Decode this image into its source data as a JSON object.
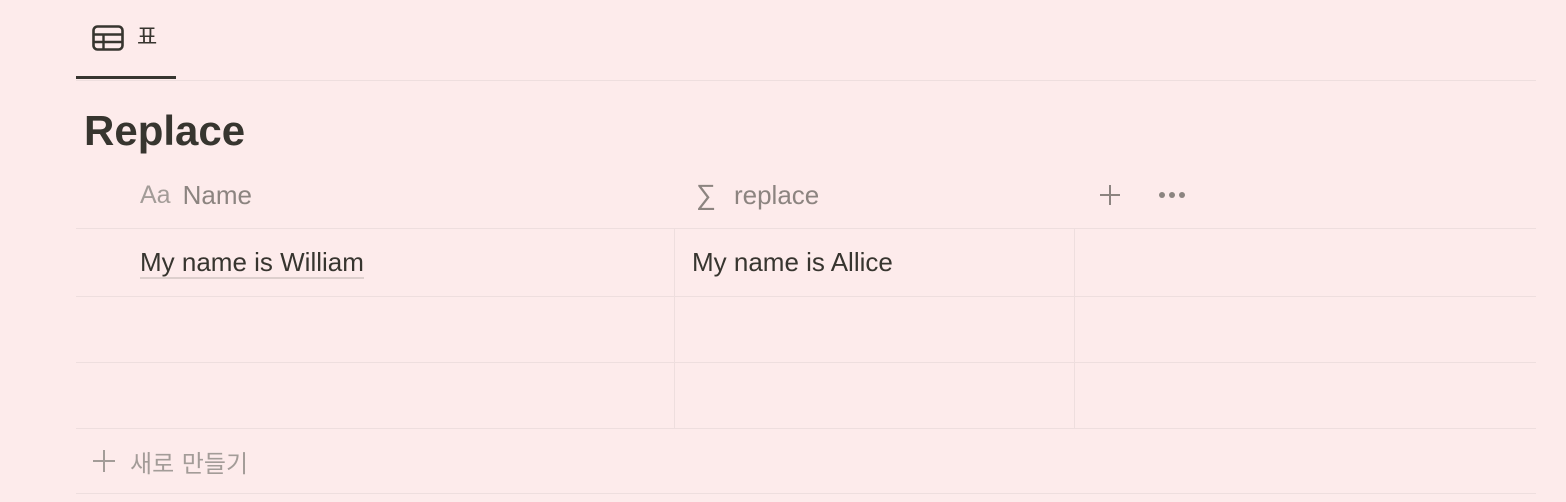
{
  "tabs": [
    {
      "label": "표",
      "icon": "table-icon",
      "active": true
    }
  ],
  "title": "Replace",
  "columns": [
    {
      "label": "Name",
      "icon": "Aa",
      "icon_name": "text-type-icon"
    },
    {
      "label": "replace",
      "icon": "∑",
      "icon_name": "sigma-formula-icon"
    }
  ],
  "header_actions": {
    "add_icon": "plus-icon",
    "more_icon": "more-horizontal-icon"
  },
  "rows": [
    {
      "name": "My name is William",
      "replace": "My name is Allice"
    },
    {
      "name": "",
      "replace": ""
    },
    {
      "name": "",
      "replace": ""
    }
  ],
  "new_row": {
    "label": "새로 만들기",
    "icon": "plus-icon"
  },
  "colors": {
    "background": "#fdebeb",
    "text": "#37352f",
    "muted": "#8c8480",
    "divider": "#eedede"
  }
}
